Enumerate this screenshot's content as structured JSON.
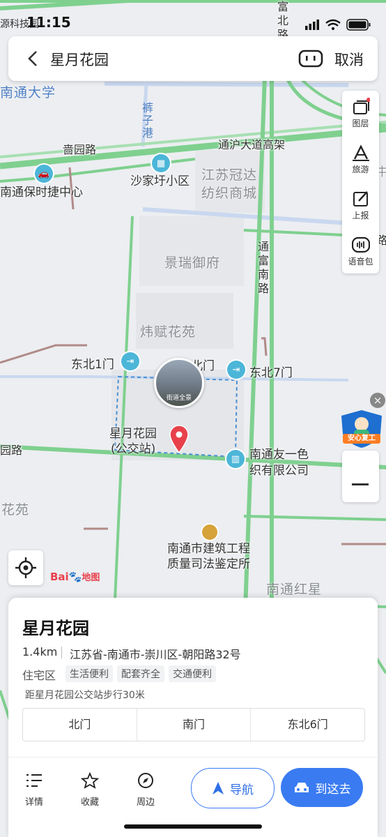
{
  "status_bar": {
    "time": "11:15",
    "carrier_overlay": "源科技园"
  },
  "search_bar": {
    "title": "星月花园",
    "cancel_label": "取消"
  },
  "map": {
    "areas": [
      "景瑞御府",
      "炜赋花苑",
      "江苏冠达",
      "纺织商城",
      "南通红星",
      "花苑",
      "南通大学"
    ],
    "roads": [
      "啬园路",
      "通沪大道高架",
      "通富南路",
      "富北路",
      "园路",
      "路"
    ],
    "water": "裤子港",
    "pois": [
      "南通保时捷中心",
      "沙家圩小区",
      "东北1门",
      "北门",
      "东北7门",
      "星月花园",
      "(公交站)",
      "南通友一色",
      "织有限公司",
      "南通市建筑工程",
      "质量司法鉴定所",
      "中"
    ],
    "street_view_label": "街道全景",
    "logo_text": "Bai",
    "logo_suffix": "地图"
  },
  "right_tools": [
    {
      "icon": "layers-icon",
      "label": "图层"
    },
    {
      "icon": "travel-icon",
      "label": "旅游"
    },
    {
      "icon": "report-icon",
      "label": "上报"
    },
    {
      "icon": "voice-pack-icon",
      "label": "语音包"
    }
  ],
  "promo_badge": "安心复工",
  "place": {
    "name": "星月花园",
    "distance": "1.4km",
    "address": "江苏省-南通市-崇川区-朝阳路32号",
    "type": "住宅区",
    "tags": [
      "生活便利",
      "配套齐全",
      "交通便利"
    ],
    "walk_hint": "距星月花园公交站步行30米",
    "gates": [
      "北门",
      "南门",
      "东北6门"
    ]
  },
  "actions": [
    {
      "icon": "details-icon",
      "label": "详情"
    },
    {
      "icon": "star-icon",
      "label": "收藏"
    },
    {
      "icon": "compass-icon",
      "label": "周边"
    }
  ],
  "nav_label": "导航",
  "go_label": "到这去",
  "colors": {
    "road_green": "#7fd08f",
    "accent_blue": "#3a7bf2",
    "pin_red": "#e8414b"
  }
}
